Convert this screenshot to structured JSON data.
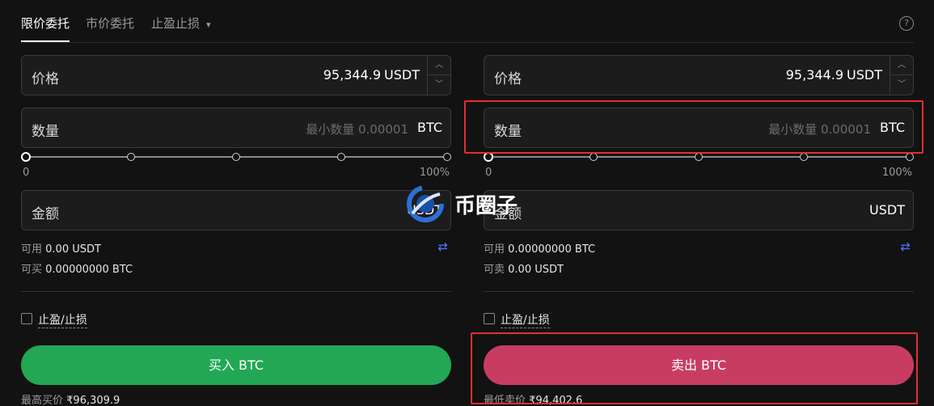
{
  "tabs": [
    {
      "label": "限价委托"
    },
    {
      "label": "市价委托"
    },
    {
      "label": "止盈止损"
    }
  ],
  "help_icon": "?",
  "buy": {
    "price_label": "价格",
    "price_value": "95,344.9",
    "price_unit": "USDT",
    "qty_label": "数量",
    "qty_placeholder": "最小数量 0.00001",
    "qty_unit": "BTC",
    "slider_min": "0",
    "slider_max": "100%",
    "amount_label": "金额",
    "amount_unit": "USDT",
    "available_label": "可用",
    "available_value": "0.00 USDT",
    "can_label": "可买",
    "can_value": "0.00000000 BTC",
    "tpsl_label": "止盈/止损",
    "button_label": "买入 BTC",
    "footer_label": "最高买价",
    "footer_value": "₹96,309.9"
  },
  "sell": {
    "price_label": "价格",
    "price_value": "95,344.9",
    "price_unit": "USDT",
    "qty_label": "数量",
    "qty_placeholder": "最小数量 0.00001",
    "qty_unit": "BTC",
    "slider_min": "0",
    "slider_max": "100%",
    "amount_label": "金额",
    "amount_unit": "USDT",
    "available_label": "可用",
    "available_value": "0.00000000 BTC",
    "can_label": "可卖",
    "can_value": "0.00 USDT",
    "tpsl_label": "止盈/止损",
    "button_label": "卖出 BTC",
    "footer_label": "最低卖价",
    "footer_value": "₹94,402.6"
  },
  "watermark": {
    "text": "币圈子"
  },
  "colors": {
    "buy": "#22a755",
    "sell": "#c93c62",
    "highlight": "#e62e2e",
    "accent": "#4a7cff"
  }
}
